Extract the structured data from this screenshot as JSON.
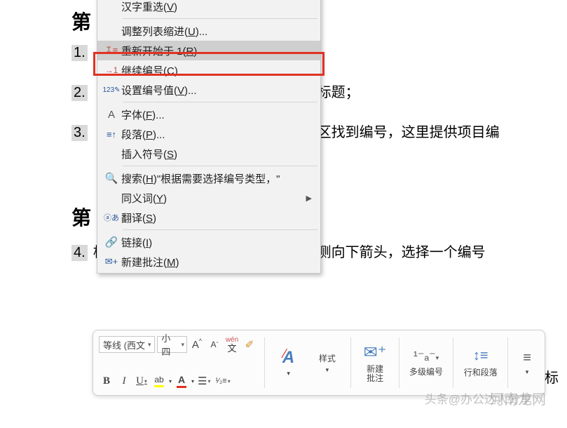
{
  "doc": {
    "heading1": "第",
    "item1_num": "1.",
    "item2_num": "2.",
    "item2_tail": "的标题；",
    "item3_num": "3.",
    "item3_tail": "能区找到编号，这里提供项目编",
    "heading2": "第",
    "item4_num": "4.",
    "item4_text": "根据需要选择编号类型，点击编号右侧向下箭头，选择一个编号",
    "tail_text": "标"
  },
  "menu": {
    "items": [
      {
        "icon": "",
        "label": "汉字重选(V)",
        "hl": "V",
        "sub": false
      },
      {
        "sep": true
      },
      {
        "icon": "",
        "label": "调整列表缩进(U)...",
        "hl": "U",
        "sub": false
      },
      {
        "icon": "↧≡",
        "label": "重新开始于 1(R)",
        "hl": "R",
        "sub": false,
        "hovered": true
      },
      {
        "icon": "→1",
        "label": "继续编号(C)",
        "hl": "C",
        "sub": false
      },
      {
        "icon": "123✎",
        "label": "设置编号值(V)...",
        "hl": "V",
        "sub": false
      },
      {
        "sep": true
      },
      {
        "icon": "A",
        "label": "字体(F)...",
        "hl": "F",
        "sub": false
      },
      {
        "icon": "≡↑",
        "label": "段落(P)...",
        "hl": "P",
        "sub": false
      },
      {
        "icon": "",
        "label": "插入符号(S)",
        "hl": "S",
        "sub": false
      },
      {
        "sep": true
      },
      {
        "icon": "🔍",
        "label": "搜索(H)\"根据需要选择编号类型，\"",
        "hl": "H",
        "sub": false
      },
      {
        "icon": "",
        "label": "同义词(Y)",
        "hl": "Y",
        "sub": true
      },
      {
        "icon": "ⓐあ",
        "label": "翻译(S)",
        "hl": "S",
        "sub": false
      },
      {
        "sep": true
      },
      {
        "icon": "🔗",
        "label": "链接(I)",
        "hl": "I",
        "sub": false
      },
      {
        "icon": "✉+",
        "label": "新建批注(M)",
        "hl": "M",
        "sub": false
      }
    ]
  },
  "toolbar": {
    "font_name": "等线 (西文",
    "font_size": "小四",
    "grow": "A↑",
    "shrink": "A↓",
    "phonetic": "wén 文",
    "fmtpainter": "✎",
    "clearfmt": "A⁄",
    "bold": "B",
    "italic": "I",
    "underline": "U",
    "highlight": "ab",
    "fontcolor": "A",
    "bullets": "≡",
    "numbering": "1≡",
    "styles": "样式",
    "newcomment": "新建\n批注",
    "multilevel": "多级编号",
    "linespace": "行和段落",
    "align": "≡"
  },
  "watermark1": "河南龙网",
  "watermark2": "头条@办公达人分享"
}
